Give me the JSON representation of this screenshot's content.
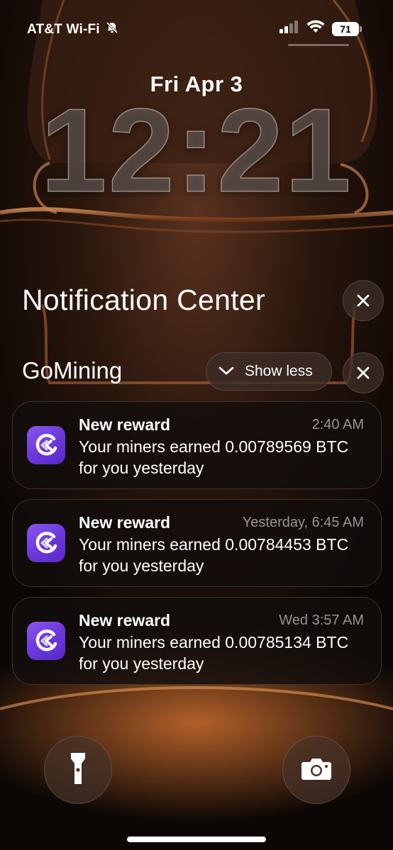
{
  "status_bar": {
    "carrier": "AT&T Wi-Fi",
    "battery_level": "71",
    "icons": [
      "silent-bell-icon",
      "cellular-signal-icon",
      "wifi-icon",
      "battery-icon"
    ]
  },
  "lock_screen": {
    "date": "Fri Apr 3",
    "time": "12:21"
  },
  "notification_center": {
    "title": "Notification Center",
    "close_icon": "close-icon"
  },
  "group": {
    "app_name": "GoMining",
    "show_less_label": "Show less",
    "chevron_icon": "chevron-down-icon",
    "close_icon": "close-icon"
  },
  "notifications": [
    {
      "title": "New reward",
      "time": "2:40 AM",
      "body": "Your miners earned 0.00789569 BTC for you yesterday"
    },
    {
      "title": "New reward",
      "time": "Yesterday, 6:45 AM",
      "body": "Your miners earned 0.00784453 BTC for you yesterday"
    },
    {
      "title": "New reward",
      "time": "Wed 3:57 AM",
      "body": "Your miners earned 0.00785134 BTC for you yesterday"
    }
  ],
  "bottom_controls": {
    "left_icon": "flashlight-icon",
    "right_icon": "camera-icon"
  },
  "colors": {
    "app_icon": "#7044e0",
    "wallpaper_glow": "#c86a2a"
  }
}
